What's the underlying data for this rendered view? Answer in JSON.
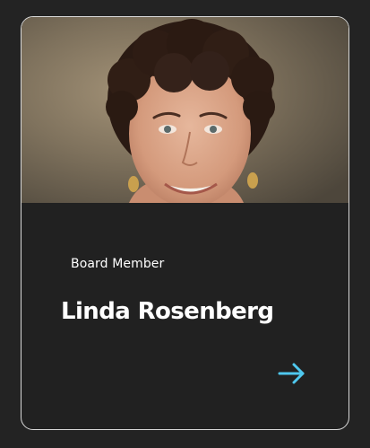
{
  "card": {
    "role": "Board Member",
    "name": "Linda Rosenberg",
    "accent_color": "#4fc8ee",
    "border_color": "#d9d9d9",
    "background_color": "#212121",
    "link_icon": "arrow-right-icon"
  }
}
